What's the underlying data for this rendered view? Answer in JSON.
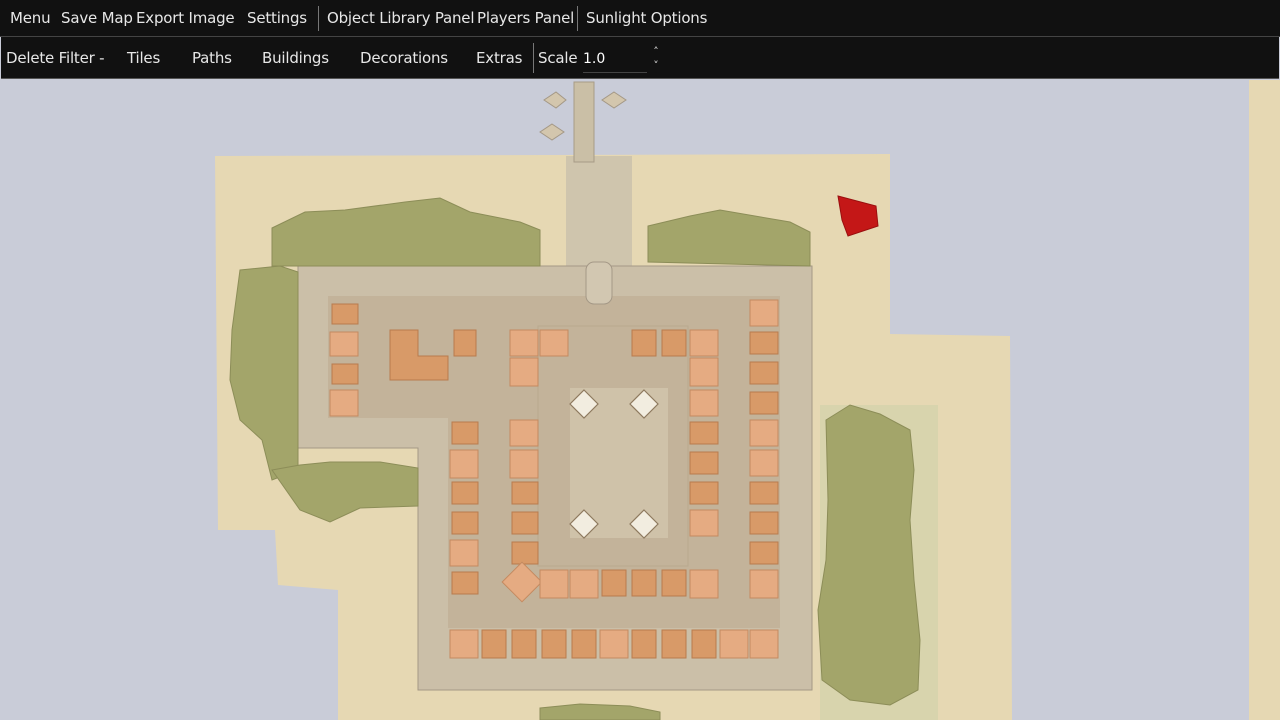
{
  "menubar": {
    "items": [
      "Menu",
      "Save Map",
      "Export Image",
      "Settings",
      "Object Library Panel",
      "Players Panel",
      "Sunlight Options"
    ]
  },
  "filterbar": {
    "delete_filter": "Delete Filter -",
    "tabs": [
      "Tiles",
      "Paths",
      "Buildings",
      "Decorations",
      "Extras"
    ],
    "scale_label": "Scale",
    "scale_value": "1.0"
  },
  "colors": {
    "toolbar_bg": "#111111",
    "water": "#c9ccd8",
    "sand": "#e6d8b3",
    "building": "#d89a68",
    "marker": "#c41717"
  }
}
